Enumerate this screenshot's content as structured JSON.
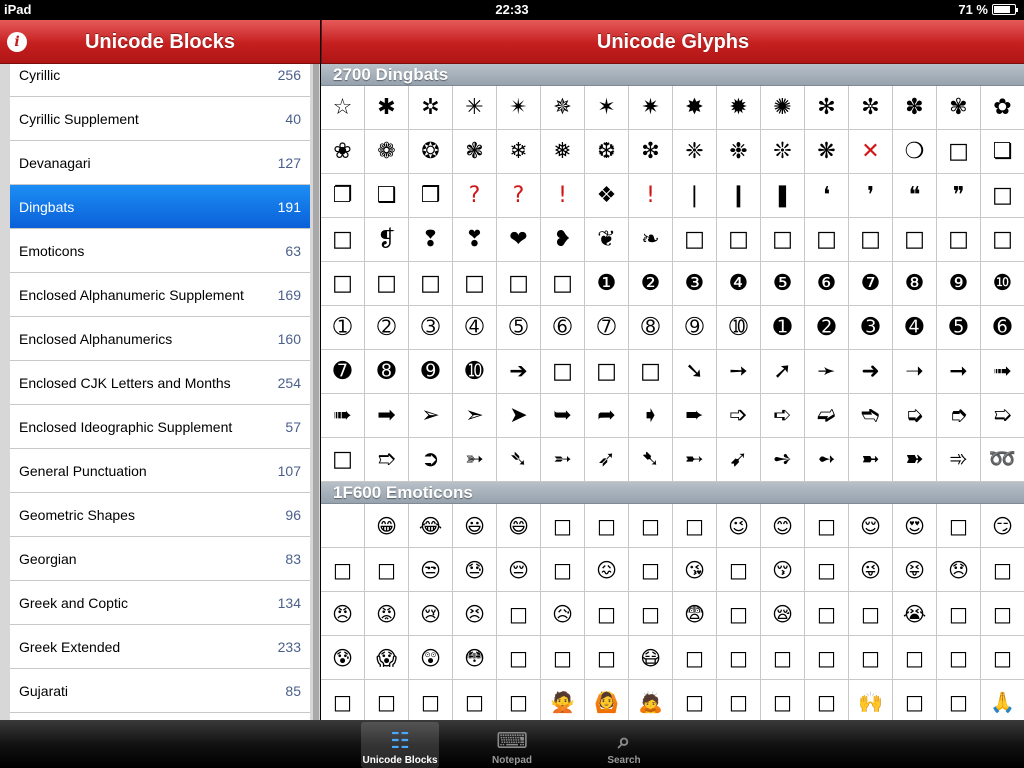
{
  "status": {
    "device": "iPad",
    "time": "22:33",
    "battery": "71 %",
    "battery_level": 0.71
  },
  "master": {
    "title": "Unicode Blocks",
    "items": [
      {
        "name": "Cyrillic",
        "count": "256"
      },
      {
        "name": "Cyrillic Supplement",
        "count": "40"
      },
      {
        "name": "Devanagari",
        "count": "127"
      },
      {
        "name": "Dingbats",
        "count": "191",
        "selected": true
      },
      {
        "name": "Emoticons",
        "count": "63"
      },
      {
        "name": "Enclosed Alphanumeric Supplement",
        "count": "169"
      },
      {
        "name": "Enclosed Alphanumerics",
        "count": "160"
      },
      {
        "name": "Enclosed CJK Letters and Months",
        "count": "254"
      },
      {
        "name": "Enclosed Ideographic Supplement",
        "count": "57"
      },
      {
        "name": "General Punctuation",
        "count": "107"
      },
      {
        "name": "Geometric Shapes",
        "count": "96"
      },
      {
        "name": "Georgian",
        "count": "83"
      },
      {
        "name": "Greek and Coptic",
        "count": "134"
      },
      {
        "name": "Greek Extended",
        "count": "233"
      },
      {
        "name": "Gujarati",
        "count": "85"
      }
    ]
  },
  "detail": {
    "title": "Unicode Glyphs",
    "sections": [
      {
        "header": "2700 Dingbats",
        "glyphs": [
          "☆",
          "✱",
          "✲",
          "✳",
          "✴",
          "✵",
          "✶",
          "✷",
          "✸",
          "✹",
          "✺",
          "✻",
          "✼",
          "✽",
          "✾",
          "✿",
          "❀",
          "❁",
          "❂",
          "❃",
          "❄",
          "❅",
          "❆",
          "❇",
          "❈",
          "❉",
          "❊",
          "❋",
          "✕",
          "❍",
          "□",
          "❏",
          "❐",
          "❑",
          "❒",
          "?",
          "?",
          "!",
          "❖",
          "!",
          "❘",
          "❙",
          "❚",
          "❛",
          "❜",
          "❝",
          "❞",
          "□",
          "□",
          "❡",
          "❢",
          "❣",
          "❤",
          "❥",
          "❦",
          "❧",
          "□",
          "□",
          "□",
          "□",
          "□",
          "□",
          "□",
          "□",
          "□",
          "□",
          "□",
          "□",
          "□",
          "□",
          "❶",
          "❷",
          "❸",
          "❹",
          "❺",
          "❻",
          "❼",
          "❽",
          "❾",
          "❿",
          "➀",
          "➁",
          "➂",
          "➃",
          "➄",
          "➅",
          "➆",
          "➇",
          "➈",
          "➉",
          "➊",
          "➋",
          "➌",
          "➍",
          "➎",
          "➏",
          "➐",
          "➑",
          "➒",
          "➓",
          "➔",
          "□",
          "□",
          "□",
          "➘",
          "➙",
          "➚",
          "➛",
          "➜",
          "➝",
          "➞",
          "➟",
          "➠",
          "➡",
          "➢",
          "➣",
          "➤",
          "➥",
          "➦",
          "➧",
          "➨",
          "➩",
          "➪",
          "➫",
          "➬",
          "➭",
          "➮",
          "➯",
          "□",
          "➱",
          "➲",
          "➳",
          "➴",
          "➵",
          "➶",
          "➷",
          "➸",
          "➹",
          "➺",
          "➻",
          "➼",
          "➽",
          "➾",
          "➿"
        ]
      },
      {
        "header": "1F600 Emoticons",
        "glyphs": [
          "",
          "😁",
          "😂",
          "😃",
          "😄",
          "□",
          "□",
          "□",
          "□",
          "😉",
          "😊",
          "□",
          "😌",
          "😍",
          "□",
          "😏",
          "□",
          "□",
          "😒",
          "😓",
          "😔",
          "□",
          "😖",
          "□",
          "😘",
          "□",
          "😚",
          "□",
          "😜",
          "😝",
          "😞",
          "□",
          "😠",
          "😡",
          "😢",
          "😣",
          "□",
          "😥",
          "□",
          "□",
          "😨",
          "□",
          "😪",
          "□",
          "□",
          "😭",
          "□",
          "□",
          "😰",
          "😱",
          "😲",
          "😳",
          "□",
          "□",
          "□",
          "😷",
          "□",
          "□",
          "□",
          "□",
          "□",
          "□",
          "□",
          "□",
          "□",
          "□",
          "□",
          "□",
          "□",
          "🙅",
          "🙆",
          "🙇",
          "□",
          "□",
          "□",
          "□",
          "🙌",
          "□",
          "□",
          "🙏"
        ]
      }
    ]
  },
  "tabs": [
    {
      "label": "Unicode Blocks",
      "icon": "cabinet-icon",
      "active": true
    },
    {
      "label": "Notepad",
      "icon": "keyboard-icon",
      "active": false
    },
    {
      "label": "Search",
      "icon": "search-icon",
      "active": false
    }
  ],
  "colors": {
    "nav_red": "#c51f1f",
    "selection_blue": "#0b60d8",
    "section_gray": "#96a2ad"
  }
}
